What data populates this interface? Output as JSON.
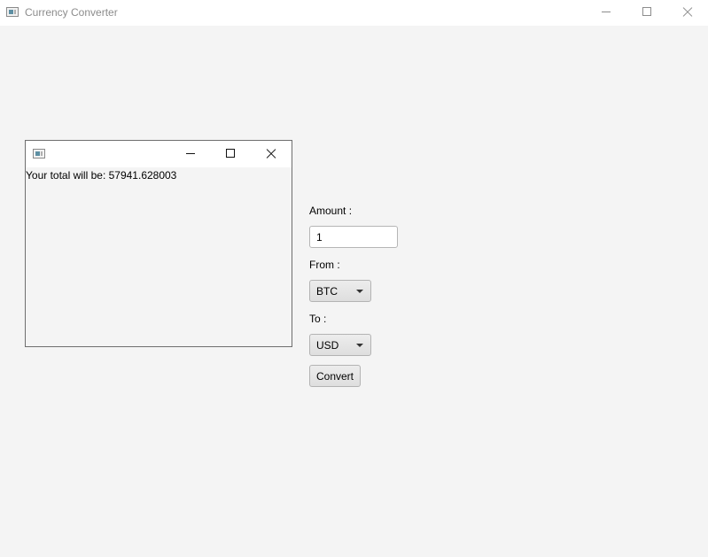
{
  "window": {
    "title": "Currency Converter",
    "minimize_icon": "minimize-icon",
    "maximize_icon": "maximize-icon",
    "close_icon": "close-icon"
  },
  "result_window": {
    "title": "",
    "message": "Your total will be: 57941.628003"
  },
  "form": {
    "amount_label": "Amount :",
    "amount_value": "1",
    "from_label": "From :",
    "from_value": "BTC",
    "to_label": "To :",
    "to_value": "USD",
    "convert_label": "Convert"
  }
}
